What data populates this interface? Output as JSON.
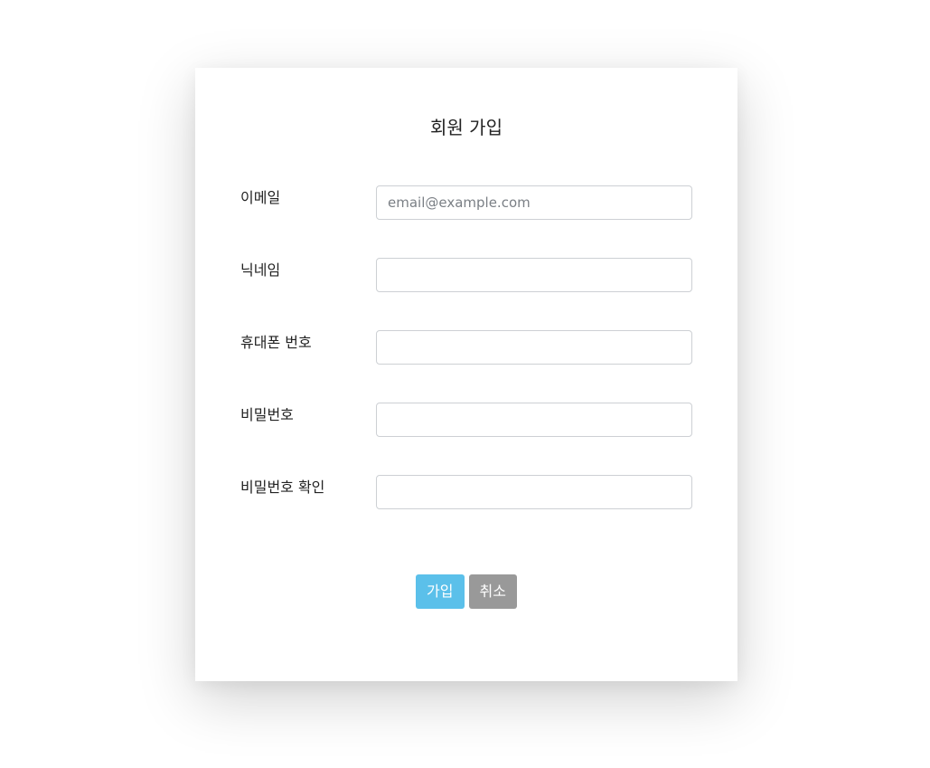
{
  "form": {
    "title": "회원 가입",
    "fields": [
      {
        "label": "이메일",
        "placeholder": "email@example.com",
        "value": ""
      },
      {
        "label": "닉네임",
        "placeholder": "",
        "value": ""
      },
      {
        "label": "휴대폰 번호",
        "placeholder": "",
        "value": ""
      },
      {
        "label": "비밀번호",
        "placeholder": "",
        "value": ""
      },
      {
        "label": "비밀번호 확인",
        "placeholder": "",
        "value": ""
      }
    ],
    "buttons": {
      "submit_label": "가입",
      "cancel_label": "취소"
    }
  },
  "colors": {
    "primary": "#5bc0ea",
    "secondary": "#999999"
  }
}
